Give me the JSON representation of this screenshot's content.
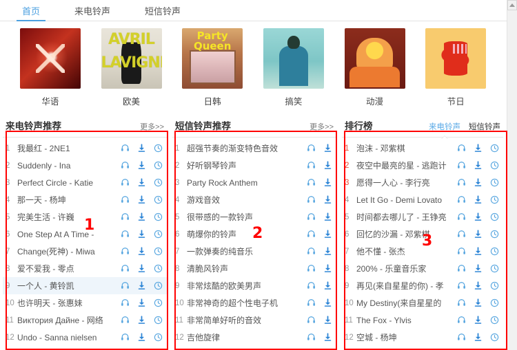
{
  "nav": {
    "tabs": [
      {
        "label": "首页",
        "active": true
      },
      {
        "label": "来电铃声",
        "active": false
      },
      {
        "label": "短信铃声",
        "active": false
      }
    ]
  },
  "categories": [
    {
      "label": "华语",
      "art": "art1"
    },
    {
      "label": "欧美",
      "art": "art2"
    },
    {
      "label": "日韩",
      "art": "art3"
    },
    {
      "label": "搞笑",
      "art": "art4"
    },
    {
      "label": "动漫",
      "art": "art5"
    },
    {
      "label": "节日",
      "art": "art6"
    }
  ],
  "columns": [
    {
      "title": "来电铃声推荐",
      "more": "更多>>",
      "icons": [
        "headphone-icon",
        "download-icon",
        "set-ringtone-icon"
      ],
      "items": [
        {
          "index": "1",
          "name": "我最红 - 2NE1"
        },
        {
          "index": "2",
          "name": "Suddenly - Ina"
        },
        {
          "index": "3",
          "name": "Perfect Circle - Katie"
        },
        {
          "index": "4",
          "name": "那一天 - 杨坤"
        },
        {
          "index": "5",
          "name": "完美生活 - 许巍"
        },
        {
          "index": "6",
          "name": "One Step At A Time -"
        },
        {
          "index": "7",
          "name": "Change(死神) - Miwa"
        },
        {
          "index": "8",
          "name": "爱不爱我 - 零点"
        },
        {
          "index": "9",
          "name": "一个人 - 黄铃凯",
          "hover": true
        },
        {
          "index": "10",
          "name": "也许明天 - 张惠妹"
        },
        {
          "index": "11",
          "name": "Виктория Дайне - 网络"
        },
        {
          "index": "12",
          "name": "Undo - Sanna nielsen"
        }
      ]
    },
    {
      "title": "短信铃声推荐",
      "more": "更多>>",
      "icons": [
        "headphone-icon",
        "download-icon"
      ],
      "items": [
        {
          "index": "1",
          "name": "超强节奏的渐变特色音效"
        },
        {
          "index": "2",
          "name": "好听钢琴铃声"
        },
        {
          "index": "3",
          "name": "Party Rock Anthem"
        },
        {
          "index": "4",
          "name": "游戏音效"
        },
        {
          "index": "5",
          "name": "很带感的一款铃声"
        },
        {
          "index": "6",
          "name": "萌爆你的铃声"
        },
        {
          "index": "7",
          "name": "一款弹奏的纯音乐"
        },
        {
          "index": "8",
          "name": "清脆风铃声"
        },
        {
          "index": "9",
          "name": "非常炫酷的欧美男声"
        },
        {
          "index": "10",
          "name": "非常神奇的超个性电子机"
        },
        {
          "index": "11",
          "name": "非常简单好听的音效"
        },
        {
          "index": "12",
          "name": "吉他旋律"
        }
      ]
    },
    {
      "title": "排行榜",
      "tabs": [
        {
          "label": "来电铃声",
          "active": true
        },
        {
          "label": "短信铃声",
          "active": false
        }
      ],
      "icons": [
        "headphone-icon",
        "download-icon",
        "set-ringtone-icon"
      ],
      "items": [
        {
          "index": "1",
          "name": "泡沫 - 邓紫棋",
          "top": true
        },
        {
          "index": "2",
          "name": "夜空中最亮的星 - 逃跑计",
          "top": true
        },
        {
          "index": "3",
          "name": "愿得一人心 - 李行亮",
          "top": true
        },
        {
          "index": "4",
          "name": "Let It Go - Demi Lovato"
        },
        {
          "index": "5",
          "name": "时间都去哪儿了 - 王铮亮"
        },
        {
          "index": "6",
          "name": "回忆的沙漏 - 邓紫棋"
        },
        {
          "index": "7",
          "name": "他不懂 - 张杰"
        },
        {
          "index": "8",
          "name": "200% - 乐童音乐家"
        },
        {
          "index": "9",
          "name": "再见(来自星星的你) - 孝"
        },
        {
          "index": "10",
          "name": "My Destiny(来自星星的"
        },
        {
          "index": "11",
          "name": "The Fox - Ylvis"
        },
        {
          "index": "12",
          "name": "空城 - 杨坤"
        }
      ]
    }
  ],
  "annotations": [
    {
      "number": "1"
    },
    {
      "number": "2"
    },
    {
      "number": "3"
    }
  ],
  "colors": {
    "accent": "#4a9fe0",
    "icon": "#4a9fe0",
    "rank_top": "#e8503a",
    "annotation": "#ff0000",
    "hover_row": "#eef5fb"
  },
  "scrollbar": {
    "up_arrow": "scroll-up-icon"
  }
}
